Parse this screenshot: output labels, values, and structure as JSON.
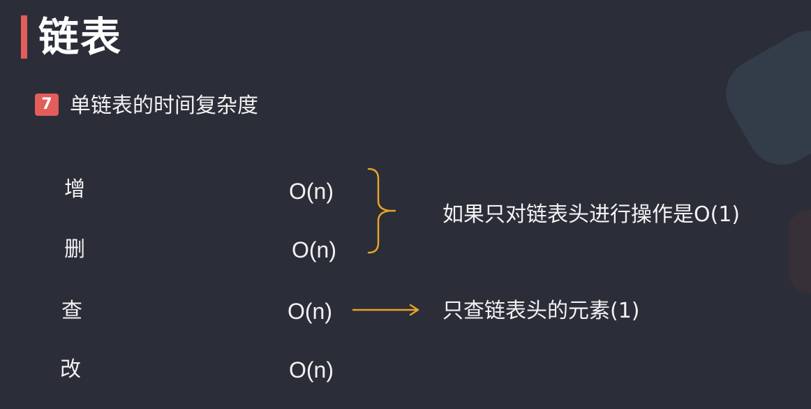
{
  "slide": {
    "title": "链表",
    "section_number": "7",
    "section_title": "单链表的时间复杂度"
  },
  "operations": [
    {
      "label": "增",
      "complexity": "O(n)"
    },
    {
      "label": "删",
      "complexity": "O(n)"
    },
    {
      "label": "查",
      "complexity": "O(n)"
    },
    {
      "label": "改",
      "complexity": "O(n)"
    }
  ],
  "notes": {
    "add_delete": "如果只对链表头进行操作是O(1)",
    "query": "只查链表头的元素(1)"
  },
  "colors": {
    "background": "#2b2d38",
    "accent_red": "#e35d5b",
    "annotation_orange": "#e8a32a",
    "text": "#f2f2f2"
  },
  "icons": {
    "brace": "right-curly-brace-icon",
    "arrow": "right-arrow-icon"
  }
}
